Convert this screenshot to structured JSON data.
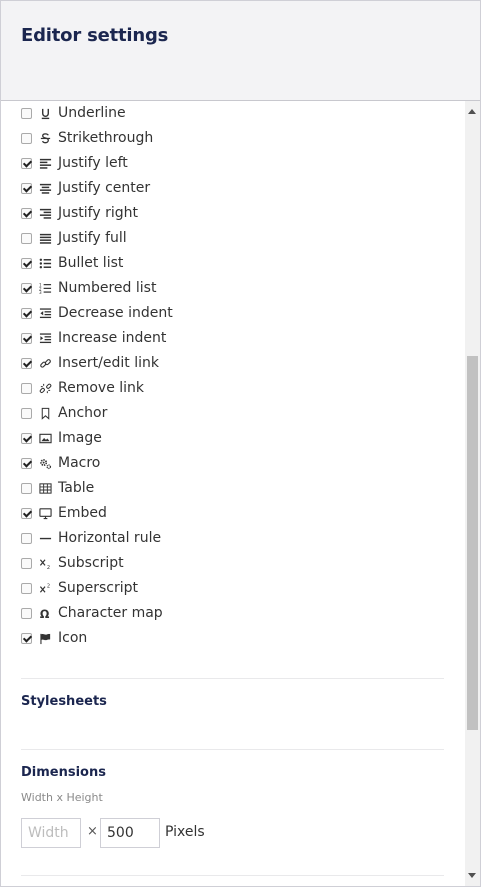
{
  "header": {
    "title": "Editor settings"
  },
  "toolbar_options": [
    {
      "label": "Underline",
      "checked": false,
      "icon": "underline-icon"
    },
    {
      "label": "Strikethrough",
      "checked": false,
      "icon": "strikethrough-icon"
    },
    {
      "label": "Justify left",
      "checked": true,
      "icon": "align-left-icon"
    },
    {
      "label": "Justify center",
      "checked": true,
      "icon": "align-center-icon"
    },
    {
      "label": "Justify right",
      "checked": true,
      "icon": "align-right-icon"
    },
    {
      "label": "Justify full",
      "checked": false,
      "icon": "align-justify-icon"
    },
    {
      "label": "Bullet list",
      "checked": true,
      "icon": "bullet-list-icon"
    },
    {
      "label": "Numbered list",
      "checked": true,
      "icon": "numbered-list-icon"
    },
    {
      "label": "Decrease indent",
      "checked": true,
      "icon": "outdent-icon"
    },
    {
      "label": "Increase indent",
      "checked": true,
      "icon": "indent-icon"
    },
    {
      "label": "Insert/edit link",
      "checked": true,
      "icon": "link-icon"
    },
    {
      "label": "Remove link",
      "checked": false,
      "icon": "unlink-icon"
    },
    {
      "label": "Anchor",
      "checked": false,
      "icon": "bookmark-icon"
    },
    {
      "label": "Image",
      "checked": true,
      "icon": "image-icon"
    },
    {
      "label": "Macro",
      "checked": true,
      "icon": "cogs-icon"
    },
    {
      "label": "Table",
      "checked": false,
      "icon": "table-icon"
    },
    {
      "label": "Embed",
      "checked": true,
      "icon": "monitor-icon"
    },
    {
      "label": "Horizontal rule",
      "checked": false,
      "icon": "hr-icon"
    },
    {
      "label": "Subscript",
      "checked": false,
      "icon": "subscript-icon"
    },
    {
      "label": "Superscript",
      "checked": false,
      "icon": "superscript-icon"
    },
    {
      "label": "Character map",
      "checked": false,
      "icon": "omega-icon"
    },
    {
      "label": "Icon",
      "checked": true,
      "icon": "flag-icon"
    }
  ],
  "stylesheets": {
    "title": "Stylesheets"
  },
  "dimensions": {
    "title": "Dimensions",
    "subtitle": "Width x Height",
    "width_placeholder": "Width",
    "width_value": "",
    "times": "×",
    "height_value": "500",
    "unit": "Pixels"
  }
}
